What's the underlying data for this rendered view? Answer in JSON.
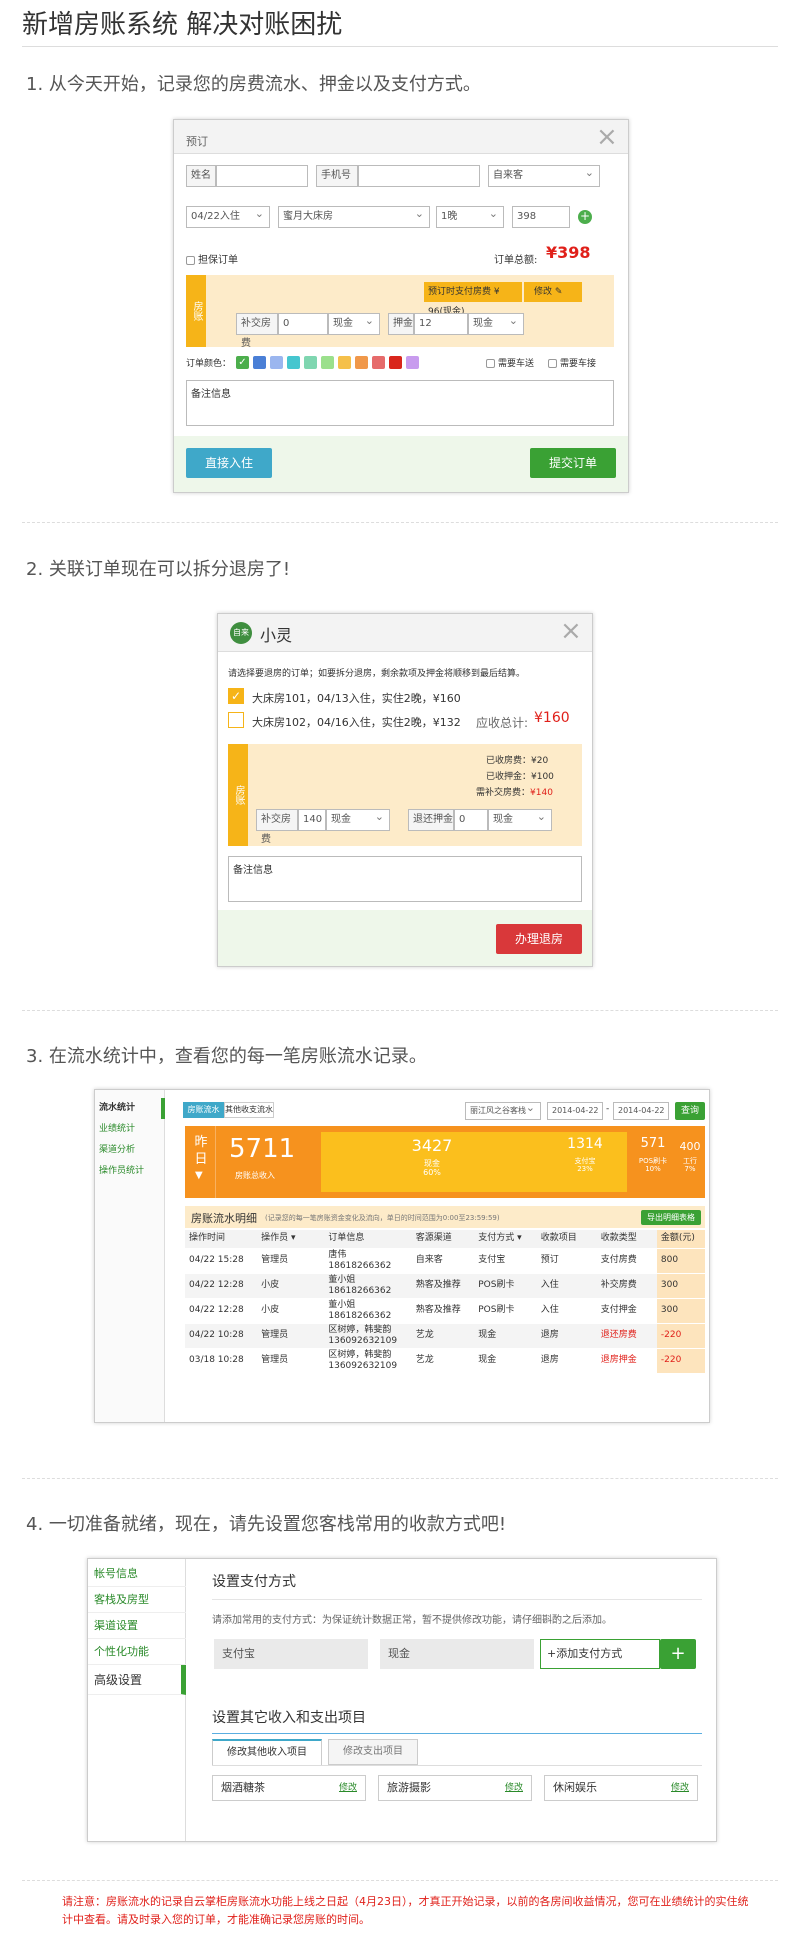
{
  "header": {
    "title": "新增房账系统  解决对账困扰"
  },
  "s1": {
    "heading": "1. 从今天开始，记录您的房费流水、押金以及支付方式。",
    "dialog_title": "预订",
    "name_label": "姓名",
    "phone_label": "手机号",
    "channel_value": "自来客",
    "checkin_value": "04/22入住",
    "room_value": "蜜月大床房",
    "nights_value": "1晚",
    "price_value": "398",
    "guarantee_label": "担保订单",
    "total_label": "订单总额:",
    "total_value": "¥398",
    "tag": "房账",
    "prepay_text": "预订时支付房费 ¥ 96(现金)",
    "edit_label": "修改",
    "supp_label": "补交房费",
    "supp_value": "0",
    "cash1": "现金",
    "deposit_label": "押金",
    "deposit_value": "12",
    "cash2": "现金",
    "color_label": "订单颜色：",
    "colors": [
      "#4cae4c",
      "#4a7fd6",
      "#9bb6ef",
      "#45c6cf",
      "#7fd6b0",
      "#9be08c",
      "#f5c04a",
      "#f0984a",
      "#e66b6b",
      "#d9261c",
      "#c89bee"
    ],
    "car_send": "需要车送",
    "car_pick": "需要车接",
    "notes": "备注信息",
    "direct_btn": "直接入住",
    "submit_btn": "提交订单"
  },
  "s2": {
    "heading": "2. 关联订单现在可以拆分退房了!",
    "logo": "自来",
    "name": "小灵",
    "hint": "请选择要退房的订单；如要拆分退房，剩余款项及押金将顺移到最后结算。",
    "opt1": "大床房101，04/13入住，实住2晚，¥160",
    "opt2": "大床房102，04/16入住，实住2晚，¥132",
    "due_label": "应收总计:",
    "due_value": "¥160",
    "tag": "房账",
    "l1": "已收房费：¥20",
    "l2": "已收押金：¥100",
    "l3k": "需补交房费：",
    "l3v": "¥140",
    "supp_label": "补交房费",
    "supp_value": "140",
    "cash1": "现金",
    "refund_label": "退还押金",
    "refund_value": "0",
    "cash2": "现金",
    "notes": "备注信息",
    "btn": "办理退房"
  },
  "s3": {
    "heading": "3. 在流水统计中，查看您的每一笔房账流水记录。",
    "nav": [
      "流水统计",
      "业绩统计",
      "渠道分析",
      "操作员统计"
    ],
    "tab1": "房账流水",
    "tab2": "其他收支流水",
    "store": "丽江风之谷客栈",
    "date1": "2014-04-22",
    "date2": "2014-04-22",
    "query": "查询",
    "day": "昨日",
    "total": "5711",
    "total_label": "房账总收入",
    "cash": "3427",
    "cash_label": "现金",
    "cash_pct": "60%",
    "alipay": "1314",
    "alipay_label": "支付宝",
    "alipay_pct": "23%",
    "pos": "571",
    "pos_label": "POS刷卡",
    "pos_pct": "10%",
    "wage": "400",
    "wage_label": "工行",
    "wage_pct": "7%",
    "detail_title": "房账流水明细",
    "detail_hint": "(记录您的每一笔房账资金变化及流向，单日的时间范围为0:00至23:59:59)",
    "export": "导出明细表格",
    "columns": [
      "操作时间",
      "操作员 ▾",
      "订单信息",
      "客源渠道",
      "支付方式 ▾",
      "收款项目",
      "收款类型",
      "金额(元)"
    ],
    "rows": [
      {
        "time": "04/22 15:28",
        "op": "管理员",
        "order1": "唐伟",
        "order2": "18618266362",
        "ch": "自来客",
        "pay": "支付宝",
        "item": "预订",
        "type": "支付房费",
        "amt": "800",
        "red": false
      },
      {
        "time": "04/22 12:28",
        "op": "小皮",
        "order1": "董小姐",
        "order2": "18618266362",
        "ch": "熟客及推荐",
        "pay": "POS刷卡",
        "item": "入住",
        "type": "补交房费",
        "amt": "300",
        "red": false
      },
      {
        "time": "04/22 12:28",
        "op": "小皮",
        "order1": "董小姐",
        "order2": "18618266362",
        "ch": "熟客及推荐",
        "pay": "POS刷卡",
        "item": "入住",
        "type": "支付押金",
        "amt": "300",
        "red": false
      },
      {
        "time": "04/22 10:28",
        "op": "管理员",
        "order1": "区树婷，韩斐韵",
        "order2": "136092632109",
        "ch": "艺龙",
        "pay": "现金",
        "item": "退房",
        "type": "退还房费",
        "amt": "-220",
        "red": true
      },
      {
        "time": "03/18 10:28",
        "op": "管理员",
        "order1": "区树婷，韩斐韵",
        "order2": "136092632109",
        "ch": "艺龙",
        "pay": "现金",
        "item": "退房",
        "type": "退房押金",
        "amt": "-220",
        "red": true
      }
    ]
  },
  "s4": {
    "heading": "4. 一切准备就绪，现在，请先设置您客栈常用的收款方式吧!",
    "nav": [
      "帐号信息",
      "客栈及房型",
      "渠道设置",
      "个性化功能",
      "高级设置"
    ],
    "title": "设置支付方式",
    "hint": "请添加常用的支付方式：为保证统计数据正常，暂不提供修改功能，请仔细斟酌之后添加。",
    "pm1": "支付宝",
    "pm2": "现金",
    "add_placeholder": "+添加支付方式",
    "add_btn": "+",
    "title2": "设置其它收入和支出项目",
    "tab1": "修改其他收入项目",
    "tab2": "修改支出项目",
    "items": [
      {
        "name": "烟酒糖茶",
        "edit": "修改"
      },
      {
        "name": "旅游摄影",
        "edit": "修改"
      },
      {
        "name": "休闲娱乐",
        "edit": "修改"
      }
    ]
  },
  "footer": {
    "note": "请注意：房账流水的记录自云掌柜房账流水功能上线之日起（4月23日），才真正开始记录，以前的各房间收益情况，您可在业绩统计的实住统计中查看。请及时录入您的订单，才能准确记录您房账的时间。"
  }
}
